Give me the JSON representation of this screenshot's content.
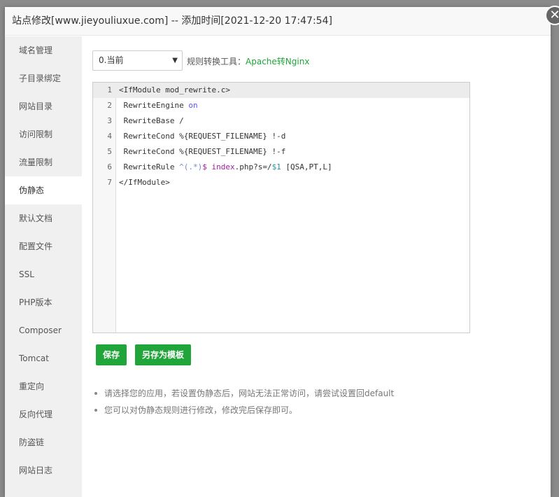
{
  "dialog": {
    "title": "站点修改[www.jieyouliuxue.com] -- 添加时间[2021-12-20 17:47:54]",
    "close_icon": "close-icon"
  },
  "sidebar": {
    "items": [
      "域名管理",
      "子目录绑定",
      "网站目录",
      "访问限制",
      "流量限制",
      "伪静态",
      "默认文档",
      "配置文件",
      "SSL",
      "PHP版本",
      "Composer",
      "Tomcat",
      "重定向",
      "反向代理",
      "防盗链",
      "网站日志"
    ],
    "active": "伪静态"
  },
  "main": {
    "template_select": "0.当前",
    "tool_label": "规则转换工具：",
    "tool_link": "Apache转Nginx",
    "editor": {
      "line_numbers": [
        "1",
        "2",
        "3",
        "4",
        "5",
        "6",
        "7"
      ],
      "lines": [
        "<IfModule mod_rewrite.c>",
        " RewriteEngine on",
        " RewriteBase /",
        " RewriteCond %{REQUEST_FILENAME} !-d",
        " RewriteCond %{REQUEST_FILENAME} !-f",
        " RewriteRule ^(.*)$ index.php?s=/$1 [QSA,PT,L]",
        "</IfModule>"
      ]
    },
    "save_button": "保存",
    "save_template_button": "另存为模板",
    "tips": [
      "请选择您的应用，若设置伪静态后，网站无法正常访问，请尝试设置回default",
      "您可以对伪静态规则进行修改，修改完后保存即可。"
    ]
  },
  "colors": {
    "accent": "#20a53a"
  }
}
